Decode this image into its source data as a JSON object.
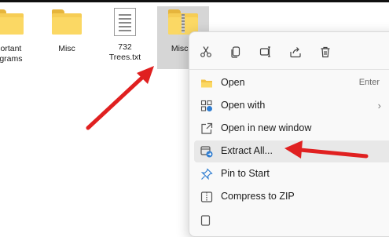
{
  "desktop": {
    "items": [
      {
        "label": "portant\nograms"
      },
      {
        "label": "Misc"
      },
      {
        "label": "732\nTrees.txt"
      },
      {
        "label": "Misc..."
      }
    ]
  },
  "context_menu": {
    "toolbar": [
      {
        "icon": "cut-icon"
      },
      {
        "icon": "copy-icon"
      },
      {
        "icon": "rename-icon"
      },
      {
        "icon": "share-icon"
      },
      {
        "icon": "delete-icon"
      }
    ],
    "items": [
      {
        "label": "Open",
        "shortcut": "Enter",
        "icon": "folder-open-icon"
      },
      {
        "label": "Open with",
        "icon": "open-with-icon"
      },
      {
        "label": "Open in new window",
        "icon": "new-window-icon"
      },
      {
        "label": "Extract All...",
        "icon": "extract-icon"
      },
      {
        "label": "Pin to Start",
        "icon": "pin-icon"
      },
      {
        "label": "Compress to ZIP",
        "icon": "zip-icon"
      }
    ]
  },
  "colors": {
    "arrow": "#e02020",
    "folder": "#f6cd55",
    "accent": "#2f7dd1"
  }
}
